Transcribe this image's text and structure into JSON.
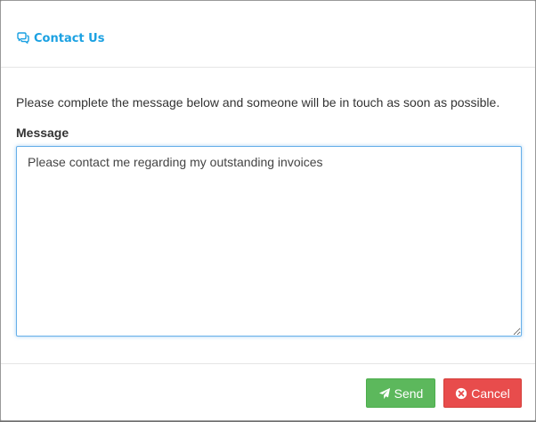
{
  "header": {
    "title": "Contact Us",
    "icon": "comments-icon",
    "accent_color": "#1ba1e2"
  },
  "body": {
    "intro_text": "Please complete the message below and someone will be in touch as soon as possible.",
    "message_label": "Message",
    "message_value": "Please contact me regarding my outstanding invoices"
  },
  "footer": {
    "send_label": "Send",
    "send_icon": "paper-plane-icon",
    "send_color": "#5cb85c",
    "cancel_label": "Cancel",
    "cancel_icon": "times-circle-icon",
    "cancel_color": "#e84c4c"
  }
}
